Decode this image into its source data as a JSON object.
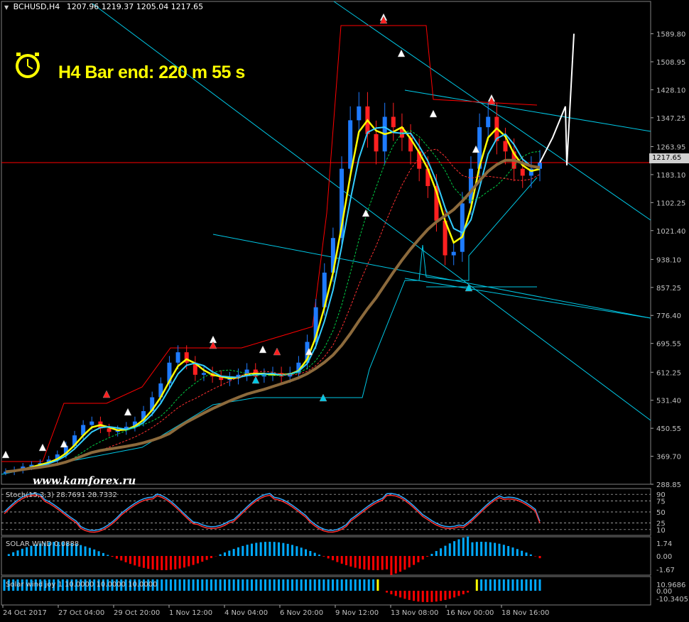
{
  "header": {
    "symbol": "BCHUSD,H4",
    "ohlc": "1207.96 1219.37 1205.04 1217.65"
  },
  "bar_end_text": "H4 Bar end: 220 m 55 s",
  "watermark": "www.kamforex.ru",
  "current_price_label": "1217.65",
  "icons": {
    "clock": "clock-icon",
    "menu": "triangle-down-icon"
  },
  "colors": {
    "background": "#000000",
    "bull_candle": "#1e7bff",
    "bear_candle": "#ff2020",
    "channel": "#ff0000",
    "trendline": "#00c8e6",
    "yellow_ma": "#ffff00",
    "price_line": "#ff0000",
    "axis_text": "#c0c0c0",
    "solar_pos": "#00aaff",
    "solar_neg": "#ff0000"
  },
  "panels": {
    "stoch_label": "Stoch(15,3,3) 28.7691 28.7332",
    "stoch_levels": [
      "90",
      "75",
      "50",
      "25",
      "10"
    ],
    "solar_label": "SOLAR WIND 0.0888",
    "solar_levels": [
      "1.74",
      "0.00",
      "-1.67"
    ],
    "solarjoy_label": "Solar wind joy 1 10.0000 10.0000 10.0000",
    "solarjoy_levels": [
      "10.9686",
      "0.00",
      "-10.3405"
    ]
  },
  "chart_data": {
    "type": "candlestick",
    "title": "BCHUSD,H4",
    "timeframe": "H4",
    "ohlc_last": {
      "open": 1207.96,
      "high": 1219.37,
      "low": 1205.04,
      "close": 1217.65
    },
    "ylim": [
      288.85,
      1630
    ],
    "y_ticks": [
      1589.8,
      1508.95,
      1428.1,
      1347.25,
      1263.95,
      1183.1,
      1102.25,
      1021.4,
      938.1,
      857.25,
      776.4,
      695.55,
      612.25,
      531.4,
      450.55,
      369.7,
      288.85
    ],
    "x_ticks": [
      "24 Oct 2017",
      "27 Oct 04:00",
      "29 Oct 20:00",
      "1 Nov 12:00",
      "4 Nov 04:00",
      "6 Nov 20:00",
      "9 Nov 12:00",
      "13 Nov 08:00",
      "16 Nov 00:00",
      "18 Nov 16:00"
    ],
    "current_price": 1217.65,
    "close_path": [
      325,
      330,
      340,
      345,
      350,
      360,
      375,
      400,
      430,
      460,
      470,
      450,
      440,
      445,
      455,
      470,
      500,
      540,
      580,
      640,
      670,
      640,
      605,
      610,
      600,
      590,
      595,
      605,
      620,
      600,
      605,
      610,
      600,
      610,
      640,
      700,
      800,
      900,
      1000,
      1200,
      1340,
      1380,
      1300,
      1250,
      1350,
      1320,
      1290,
      1250,
      1200,
      1150,
      1050,
      950,
      960,
      1100,
      1200,
      1320,
      1350,
      1280,
      1250,
      1200,
      1180,
      1200,
      1217.65
    ],
    "projection": [
      1217.65,
      1290,
      1380,
      1210,
      1590
    ],
    "grid": false,
    "stochastic": {
      "k": 28.7691,
      "d": 28.7332,
      "levels": [
        90,
        75,
        50,
        25,
        10
      ]
    },
    "solar_wind": {
      "value": 0.0888,
      "max": 1.74,
      "min": -1.67
    },
    "solar_wind_joy": {
      "params": [
        1,
        10.0,
        10.0,
        10.0
      ],
      "max": 10.9686,
      "min": -10.3405
    }
  }
}
